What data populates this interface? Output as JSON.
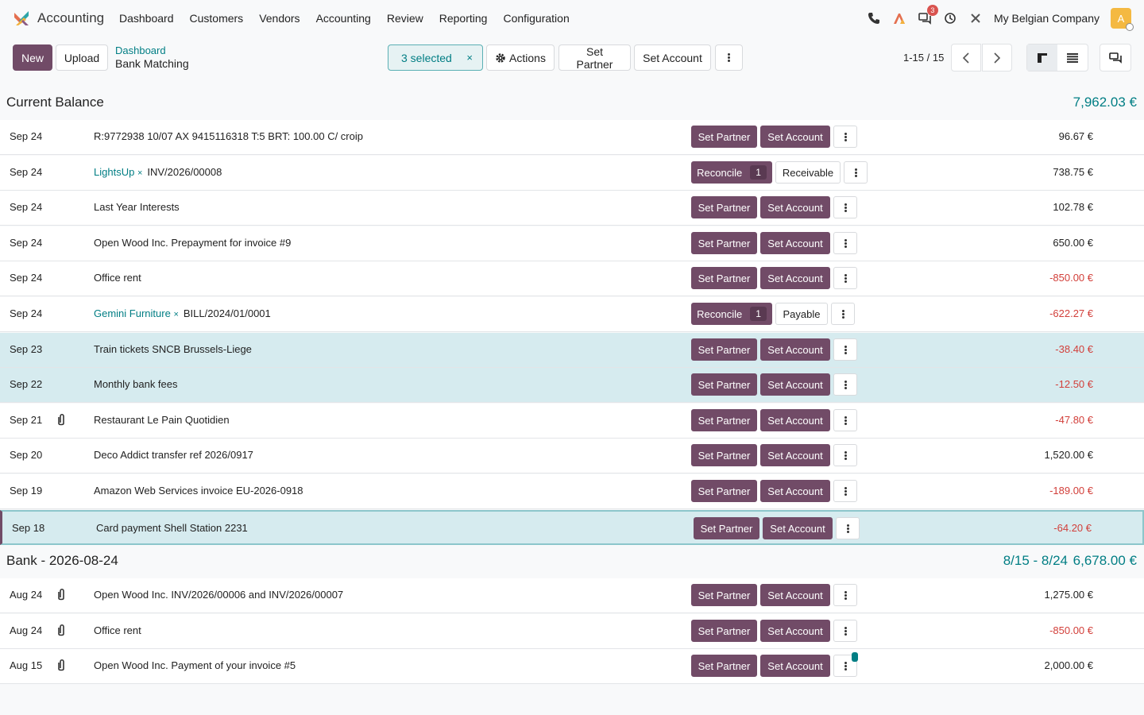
{
  "navbar": {
    "app_name": "Accounting",
    "menu": [
      "Dashboard",
      "Customers",
      "Vendors",
      "Accounting",
      "Review",
      "Reporting",
      "Configuration"
    ],
    "messages_badge": "3",
    "company": "My Belgian Company",
    "avatar_letter": "A"
  },
  "control": {
    "new_label": "New",
    "upload_label": "Upload",
    "breadcrumb_parent": "Dashboard",
    "breadcrumb_current": "Bank Matching",
    "selected_label": "3 selected",
    "selected_clear": "×",
    "actions_label": "Actions",
    "set_partner_label": "Set Partner",
    "set_account_label": "Set Account",
    "pager": "1-15 / 15"
  },
  "groups": [
    {
      "title": "Current Balance",
      "range": "",
      "amount": "7,962.03 €"
    },
    {
      "title": "Bank - 2026-08-24",
      "range": "8/15 - 8/24",
      "amount": "6,678.00 €"
    }
  ],
  "rows": [
    {
      "date": "Sep 24",
      "partner": "",
      "label": "R:9772938 10/07 AX 9415116318 T:5 BRT: 100.00 C/ croip",
      "amount": "96.67 €",
      "negative": false,
      "kind": "default",
      "attachment": false,
      "selected": false
    },
    {
      "date": "Sep 24",
      "partner": "LightsUp",
      "label": "INV/2026/00008",
      "amount": "738.75 €",
      "negative": false,
      "kind": "reconcile",
      "reconcile_label": "Reconcile",
      "reconcile_count": "1",
      "account": "Receivable",
      "attachment": false,
      "selected": false
    },
    {
      "date": "Sep 24",
      "partner": "",
      "label": "Last Year Interests",
      "amount": "102.78 €",
      "negative": false,
      "kind": "default",
      "attachment": false,
      "selected": false
    },
    {
      "date": "Sep 24",
      "partner": "",
      "label": "Open Wood Inc. Prepayment for invoice #9",
      "amount": "650.00 €",
      "negative": false,
      "kind": "default",
      "attachment": false,
      "selected": false
    },
    {
      "date": "Sep 24",
      "partner": "",
      "label": "Office rent",
      "amount": "-850.00 €",
      "negative": true,
      "kind": "default",
      "attachment": false,
      "selected": false
    },
    {
      "date": "Sep 24",
      "partner": "Gemini Furniture",
      "label": "BILL/2024/01/0001",
      "amount": "-622.27 €",
      "negative": true,
      "kind": "reconcile",
      "reconcile_label": "Reconcile",
      "reconcile_count": "1",
      "account": "Payable",
      "attachment": false,
      "selected": false
    },
    {
      "date": "Sep 23",
      "partner": "",
      "label": "Train tickets SNCB Brussels-Liege",
      "amount": "-38.40 €",
      "negative": true,
      "kind": "default",
      "attachment": false,
      "selected": true
    },
    {
      "date": "Sep 22",
      "partner": "",
      "label": "Monthly bank fees",
      "amount": "-12.50 €",
      "negative": true,
      "kind": "default",
      "attachment": false,
      "selected": true
    },
    {
      "date": "Sep 21",
      "partner": "",
      "label": "Restaurant Le Pain Quotidien",
      "amount": "-47.80 €",
      "negative": true,
      "kind": "default",
      "attachment": true,
      "selected": false
    },
    {
      "date": "Sep 20",
      "partner": "",
      "label": "Deco Addict transfer ref 2026/0917",
      "amount": "1,520.00 €",
      "negative": false,
      "kind": "default",
      "attachment": false,
      "selected": false
    },
    {
      "date": "Sep 19",
      "partner": "",
      "label": "Amazon Web Services invoice EU-2026-0918",
      "amount": "-189.00 €",
      "negative": true,
      "kind": "default",
      "attachment": false,
      "selected": false
    },
    {
      "date": "Sep 18",
      "partner": "",
      "label": "Card payment Shell Station 2231",
      "amount": "-64.20 €",
      "negative": true,
      "kind": "default",
      "attachment": false,
      "selected": true,
      "current": true
    },
    {
      "date": "Aug 24",
      "partner": "",
      "label": "Open Wood Inc. INV/2026/00006 and INV/2026/00007",
      "amount": "1,275.00 €",
      "negative": false,
      "kind": "default",
      "attachment": true,
      "selected": false
    },
    {
      "date": "Aug 24",
      "partner": "",
      "label": "Office rent",
      "amount": "-850.00 €",
      "negative": true,
      "kind": "default",
      "attachment": true,
      "selected": false
    },
    {
      "date": "Aug 15",
      "partner": "",
      "label": "Open Wood Inc. Payment of your invoice #5",
      "amount": "2,000.00 €",
      "negative": false,
      "kind": "default",
      "attachment": true,
      "selected": false,
      "marker": true
    }
  ],
  "row_buttons": {
    "set_partner": "Set Partner",
    "set_account": "Set Account",
    "partner_remove": "×"
  },
  "colors": {
    "primary": "#714b67",
    "teal": "#017e84",
    "negative": "#d23f3a",
    "selected_row": "#d6ebef"
  },
  "icons": [
    "app-logo-icon",
    "phone-icon",
    "activity-icon",
    "messages-icon",
    "clock-icon",
    "tools-icon",
    "gear-icon",
    "kebab-icon",
    "chevron-left-icon",
    "chevron-right-icon",
    "kanban-icon",
    "list-icon",
    "chat-icon",
    "paperclip-icon"
  ]
}
